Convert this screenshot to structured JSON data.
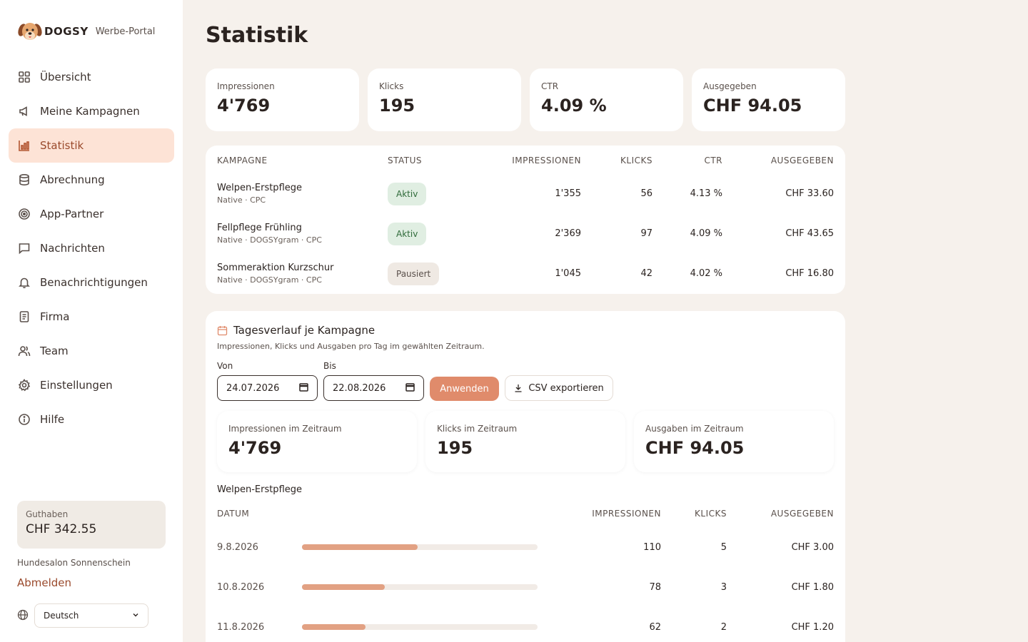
{
  "brand": {
    "name": "DOGSY",
    "subtitle": "Werbe-Portal"
  },
  "sidebar": {
    "items": [
      {
        "label": "Übersicht",
        "icon": "grid-icon"
      },
      {
        "label": "Meine Kampagnen",
        "icon": "megaphone-icon"
      },
      {
        "label": "Statistik",
        "icon": "bar-chart-icon",
        "active": true
      },
      {
        "label": "Abrechnung",
        "icon": "database-icon"
      },
      {
        "label": "App-Partner",
        "icon": "target-icon"
      },
      {
        "label": "Nachrichten",
        "icon": "message-icon"
      },
      {
        "label": "Benachrichtigungen",
        "icon": "bell-icon"
      },
      {
        "label": "Firma",
        "icon": "document-icon"
      },
      {
        "label": "Team",
        "icon": "users-icon"
      },
      {
        "label": "Einstellungen",
        "icon": "gear-icon"
      },
      {
        "label": "Hilfe",
        "icon": "info-icon"
      }
    ],
    "credit_label": "Guthaben",
    "credit_value": "CHF 342.55",
    "company": "Hundesalon Sonnenschein",
    "logout": "Abmelden",
    "language": "Deutsch"
  },
  "page_title": "Statistik",
  "kpis": [
    {
      "label": "Impressionen",
      "value": "4'769"
    },
    {
      "label": "Klicks",
      "value": "195"
    },
    {
      "label": "CTR",
      "value": "4.09 %"
    },
    {
      "label": "Ausgegeben",
      "value": "CHF 94.05"
    }
  ],
  "campaign_table": {
    "headers": [
      "KAMPAGNE",
      "STATUS",
      "IMPRESSIONEN",
      "KLICKS",
      "CTR",
      "AUSGEGEBEN"
    ],
    "rows": [
      {
        "name": "Welpen-Erstpflege",
        "sub": "Native · CPC",
        "status": "Aktiv",
        "impressions": "1'355",
        "clicks": "56",
        "ctr": "4.13 %",
        "spent": "CHF 33.60"
      },
      {
        "name": "Fellpflege Frühling",
        "sub": "Native · DOGSYgram · CPC",
        "status": "Aktiv",
        "impressions": "2'369",
        "clicks": "97",
        "ctr": "4.09 %",
        "spent": "CHF 43.65"
      },
      {
        "name": "Sommeraktion Kurzschur",
        "sub": "Native · DOGSYgram · CPC",
        "status": "Pausiert",
        "impressions": "1'045",
        "clicks": "42",
        "ctr": "4.02 %",
        "spent": "CHF 16.80"
      }
    ]
  },
  "daily": {
    "title": "Tagesverlauf je Kampagne",
    "description": "Impressionen, Klicks und Ausgaben pro Tag im gewählten Zeitraum.",
    "from_label": "Von",
    "from_value": "24.07.2026",
    "to_label": "Bis",
    "to_value": "22.08.2026",
    "apply_label": "Anwenden",
    "csv_label": "CSV exportieren",
    "summary": [
      {
        "label": "Impressionen im Zeitraum",
        "value": "4'769"
      },
      {
        "label": "Klicks im Zeitraum",
        "value": "195"
      },
      {
        "label": "Ausgaben im Zeitraum",
        "value": "CHF 94.05"
      }
    ],
    "campaign_name": "Welpen-Erstpflege",
    "headers": [
      "DATUM",
      "IMPRESSIONEN",
      "KLICKS",
      "AUSGEGEBEN"
    ],
    "rows": [
      {
        "date": "9.8.2026",
        "impressions": "110",
        "clicks": "5",
        "spent": "CHF 3.00",
        "bar_fraction": 0.49
      },
      {
        "date": "10.8.2026",
        "impressions": "78",
        "clicks": "3",
        "spent": "CHF 1.80",
        "bar_fraction": 0.35
      },
      {
        "date": "11.8.2026",
        "impressions": "62",
        "clicks": "2",
        "spent": "CHF 1.20",
        "bar_fraction": 0.27
      }
    ]
  },
  "colors": {
    "accent": "#e08b6b",
    "active_bg": "#fde3d6",
    "active_text": "#9a4a2c",
    "bar": "#e2a183",
    "page_bg": "#f6f1ec"
  }
}
